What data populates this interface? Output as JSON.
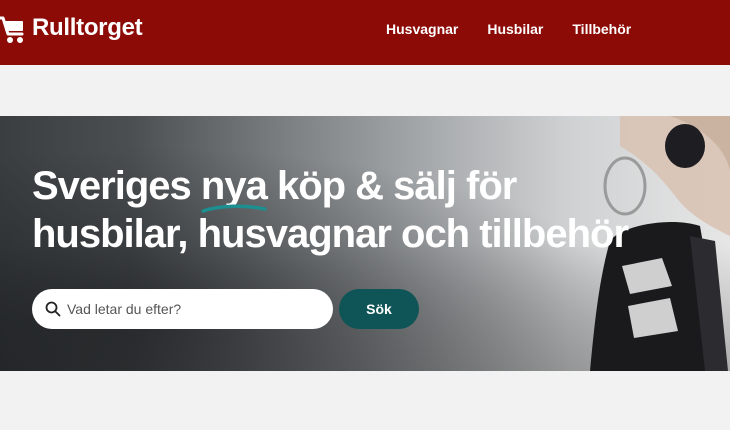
{
  "brand": {
    "name": "Rulltorget",
    "color": "#8c0b06"
  },
  "nav": {
    "items": [
      {
        "label": "Husvagnar"
      },
      {
        "label": "Husbilar"
      },
      {
        "label": "Tillbehör"
      }
    ]
  },
  "hero": {
    "title_part1": "Sveriges ",
    "title_highlight": "nya",
    "title_part2": " köp & sälj för husbilar, husvagnar och tillbehör",
    "underline_color": "#1d8f90"
  },
  "search": {
    "placeholder": "Vad letar du efter?",
    "button_label": "Sök",
    "button_color": "#0f5457",
    "icon": "search-icon"
  }
}
